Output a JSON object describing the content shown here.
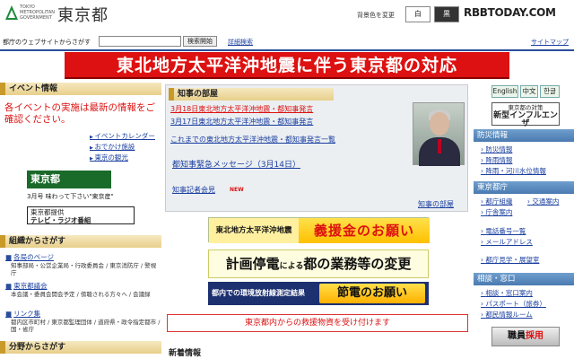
{
  "header": {
    "logo_small": "TOKYO METROPOLITAN GOVERNMENT",
    "logo_big": "東京都",
    "bg_color_label": "背景色を変更",
    "bg_white": "白",
    "bg_black": "黒",
    "watermark": "RBBTODAY.COM"
  },
  "search": {
    "label": "都庁のウェブサイトからさがす",
    "button": "検索開始",
    "advanced": "詳細検索",
    "sitemap": "サイトマップ"
  },
  "banner": "東北地方太平洋沖地震に伴う東京都の対応",
  "left": {
    "event_head": "イベント情報",
    "event_notice": "各イベントの実施は最新の情報をご確認ください。",
    "event_links": [
      "イベントカレンダー",
      "おでかけ施設",
      "東京の観光"
    ],
    "koho_logo": "東京都",
    "koho_sub": "3月号 味わって下さい\"東京産\"",
    "tv_radio_line1": "東京都提供",
    "tv_radio_line2": "テレビ・ラジオ番組",
    "org_head": "組織からさがす",
    "org_items": [
      {
        "label": "各局のページ",
        "desc": "知事部局・公営企業局・行政委員会 / 東京消防庁 / 警視庁"
      },
      {
        "label": "東京都議会",
        "desc": "本会議・委員会開会予定 / 傍聴される方々へ / 会議録"
      },
      {
        "label": "リンク集",
        "desc": "都内区市町村 / 東京都監理団体 / 道府県・政令指定都市 / 国・省庁"
      }
    ],
    "field_head": "分野からさがす"
  },
  "governor": {
    "head": "知事の部屋",
    "links": [
      "3月18日東北地方太平洋沖地震・都知事発言",
      "3月17日東北地方太平洋沖地震・都知事発言",
      "これまでの東北地方太平洋沖地震・都知事発言一覧"
    ],
    "emergency_msg": "都知事緊急メッセージ（3月14日）",
    "press": "知事記者会見",
    "new_badge": "NEW",
    "room_link": "知事の部屋"
  },
  "promos": {
    "donation_a": "東北地方太平洋沖地震",
    "donation_b": "義援金のお願い",
    "outage_a": "計画停電",
    "outage_b": "による",
    "outage_c": "都の業務等の変更",
    "radiation_a": "都内での環境放射線測定結果",
    "radiation_b": "節電のお願い",
    "relief": "東京都内からの救援物資を受け付けます",
    "news_head": "新着情報"
  },
  "right": {
    "lang_en": "English",
    "lang_zh": "中文",
    "lang_ko": "한글",
    "flu_line1": "東京都の対策",
    "flu_line2": "新型インフルエンザ",
    "disaster_head": "防災情報",
    "disaster_links": [
      "防災情報",
      "降雨情報",
      "降雨・河川水位情報"
    ],
    "office_head": "東京都庁",
    "office_links": [
      "都庁組織",
      "交通案内",
      "庁舎案内",
      "電話番号一覧",
      "メールアドレス",
      "都庁見学・展望室"
    ],
    "consult_head": "相談・窓口",
    "consult_links": [
      "相談・窓口案内",
      "パスポート（旅券）",
      "都民情報ルーム"
    ],
    "recruit_a": "職員",
    "recruit_b": "採用"
  }
}
